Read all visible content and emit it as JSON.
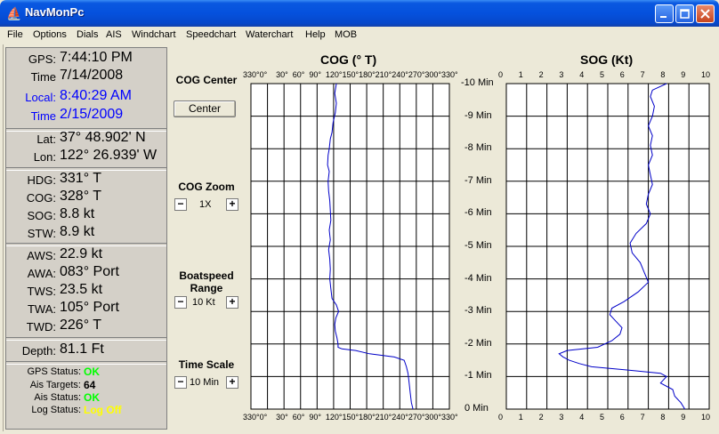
{
  "window": {
    "title": "NavMonPc"
  },
  "menu": [
    "File",
    "Options",
    "Dials",
    "AIS",
    "Windchart",
    "Speedchart",
    "Waterchart",
    "Help",
    "MOB"
  ],
  "left": {
    "gps": {
      "label": "GPS:",
      "value": "7:44:10 PM"
    },
    "time": {
      "label": "Time",
      "value": "7/14/2008"
    },
    "local": {
      "label": "Local:",
      "value": "8:40:29 AM"
    },
    "time2": {
      "label": "Time",
      "value": "2/15/2009"
    },
    "lat": {
      "label": "Lat:",
      "value": "37° 48.902' N"
    },
    "lon": {
      "label": "Lon:",
      "value": "122° 26.939' W"
    },
    "hdg": {
      "label": "HDG:",
      "value": "331° T"
    },
    "cog": {
      "label": "COG:",
      "value": "328° T"
    },
    "sog": {
      "label": "SOG:",
      "value": "8.8 kt"
    },
    "stw": {
      "label": "STW:",
      "value": "8.9 kt"
    },
    "aws": {
      "label": "AWS:",
      "value": "22.9 kt"
    },
    "awa": {
      "label": "AWA:",
      "value": "083° Port"
    },
    "tws": {
      "label": "TWS:",
      "value": "23.5 kt"
    },
    "twa": {
      "label": "TWA:",
      "value": "105° Port"
    },
    "twd": {
      "label": "TWD:",
      "value": "226° T"
    },
    "depth": {
      "label": "Depth:",
      "value": "81.1 Ft"
    },
    "status": {
      "gps": {
        "label": "GPS Status:",
        "value": "OK"
      },
      "ais_targets": {
        "label": "Ais Targets:",
        "value": "64"
      },
      "ais": {
        "label": "Ais Status:",
        "value": "OK"
      },
      "log": {
        "label": "Log Status:",
        "value": "Log Off"
      }
    }
  },
  "controls": {
    "cog_center": {
      "label": "COG Center",
      "button": "Center"
    },
    "cog_zoom": {
      "label": "COG Zoom",
      "value": "1X",
      "minus": "−",
      "plus": "+"
    },
    "boatspeed": {
      "label1": "Boatspeed",
      "label2": "Range",
      "value": "10 Kt",
      "minus": "−",
      "plus": "+"
    },
    "timescale": {
      "label": "Time Scale",
      "value": "10 Min",
      "minus": "−",
      "plus": "+"
    }
  },
  "colors": {
    "ok": "#00ff00",
    "logoff": "#ffff00",
    "local": "#0000ff",
    "series": "#0000c8"
  },
  "chart_data": [
    {
      "type": "line",
      "title": "COG (° T)",
      "x_ticks": [
        "330°",
        "0°",
        "30°",
        "60°",
        "90°",
        "120°",
        "150°",
        "180°",
        "210°",
        "240°",
        "270°",
        "300°",
        "330°"
      ],
      "y_ticks": [
        "-10 Min",
        "-9 Min",
        "-8 Min",
        "-7 Min",
        "-6 Min",
        "-5 Min",
        "-4 Min",
        "-3 Min",
        "-2 Min",
        "-1 Min",
        "0 Min"
      ],
      "xlim": [
        330,
        690
      ],
      "ylim": [
        -10,
        0
      ],
      "grid": true,
      "series": [
        {
          "points": [
            [
              -10,
              485
            ],
            [
              -9.7,
              482
            ],
            [
              -9.4,
              485
            ],
            [
              -9.1,
              483
            ],
            [
              -8.8,
              479
            ],
            [
              -8.5,
              477
            ],
            [
              -8.3,
              474
            ],
            [
              -8.0,
              472
            ],
            [
              -7.8,
              470
            ],
            [
              -7.5,
              469
            ],
            [
              -7.3,
              472
            ],
            [
              -7.0,
              470
            ],
            [
              -6.7,
              471
            ],
            [
              -6.4,
              473
            ],
            [
              -6.1,
              474
            ],
            [
              -5.8,
              475
            ],
            [
              -5.5,
              472
            ],
            [
              -5.2,
              474
            ],
            [
              -4.9,
              471
            ],
            [
              -4.6,
              473
            ],
            [
              -4.3,
              474
            ],
            [
              -4.0,
              473
            ],
            [
              -3.7,
              475
            ],
            [
              -3.4,
              477
            ],
            [
              -3.2,
              485
            ],
            [
              -3.0,
              489
            ],
            [
              -2.8,
              484
            ],
            [
              -2.6,
              482
            ],
            [
              -2.4,
              483
            ],
            [
              -2.2,
              486
            ],
            [
              -2.0,
              488
            ],
            [
              -1.9,
              488
            ],
            [
              -1.85,
              495
            ],
            [
              -1.8,
              520
            ],
            [
              -1.7,
              545
            ],
            [
              -1.6,
              590
            ],
            [
              -1.5,
              608
            ],
            [
              -1.3,
              612
            ],
            [
              -1.1,
              615
            ],
            [
              -0.8,
              617
            ],
            [
              -0.5,
              619
            ],
            [
              -0.2,
              621
            ],
            [
              0,
              624
            ]
          ]
        }
      ]
    },
    {
      "type": "line",
      "title": "SOG (Kt)",
      "x_ticks": [
        "0",
        "1",
        "2",
        "3",
        "4",
        "5",
        "6",
        "7",
        "8",
        "9",
        "10"
      ],
      "y_ticks": [],
      "xlim": [
        0,
        10
      ],
      "ylim": [
        -10,
        0
      ],
      "grid": true,
      "series": [
        {
          "points": [
            [
              -10,
              7.9
            ],
            [
              -9.8,
              7.2
            ],
            [
              -9.6,
              7.1
            ],
            [
              -9.3,
              7.3
            ],
            [
              -9.0,
              7.2
            ],
            [
              -8.7,
              7.0
            ],
            [
              -8.4,
              7.2
            ],
            [
              -8.1,
              7.1
            ],
            [
              -7.8,
              7.2
            ],
            [
              -7.5,
              7.0
            ],
            [
              -7.2,
              7.1
            ],
            [
              -6.9,
              7.2
            ],
            [
              -6.6,
              7.0
            ],
            [
              -6.3,
              6.9
            ],
            [
              -6.0,
              7.1
            ],
            [
              -5.7,
              6.9
            ],
            [
              -5.4,
              6.4
            ],
            [
              -5.1,
              6.1
            ],
            [
              -4.8,
              6.2
            ],
            [
              -4.5,
              6.6
            ],
            [
              -4.2,
              6.8
            ],
            [
              -3.9,
              7.0
            ],
            [
              -3.6,
              6.5
            ],
            [
              -3.3,
              5.8
            ],
            [
              -3.1,
              5.2
            ],
            [
              -2.9,
              5.1
            ],
            [
              -2.7,
              5.4
            ],
            [
              -2.5,
              5.7
            ],
            [
              -2.3,
              5.6
            ],
            [
              -2.1,
              5.2
            ],
            [
              -1.9,
              4.5
            ],
            [
              -1.8,
              3.0
            ],
            [
              -1.7,
              2.6
            ],
            [
              -1.6,
              2.8
            ],
            [
              -1.5,
              3.1
            ],
            [
              -1.4,
              3.6
            ],
            [
              -1.3,
              4.2
            ],
            [
              -1.2,
              6.0
            ],
            [
              -1.1,
              7.6
            ],
            [
              -1.0,
              7.9
            ],
            [
              -0.8,
              7.6
            ],
            [
              -0.6,
              8.2
            ],
            [
              -0.4,
              8.3
            ],
            [
              -0.2,
              8.6
            ],
            [
              0,
              8.8
            ]
          ]
        }
      ]
    }
  ]
}
